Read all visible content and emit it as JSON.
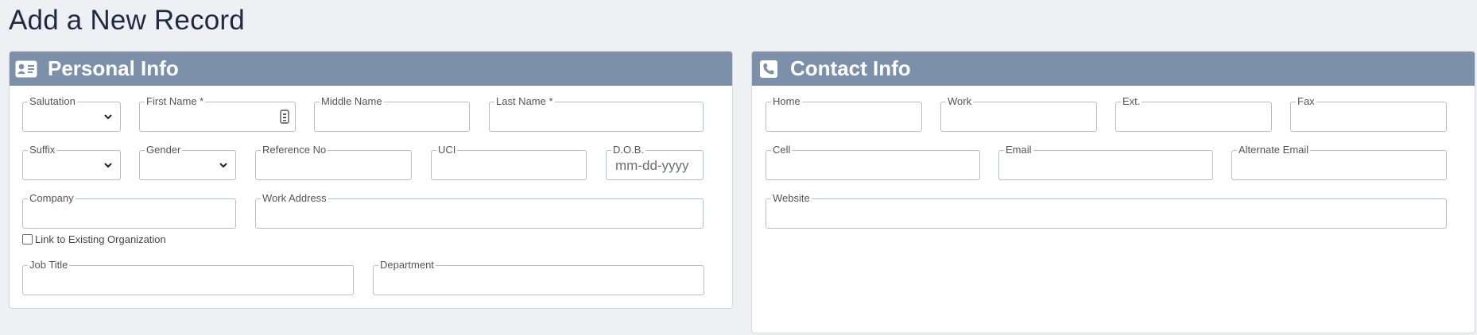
{
  "page": {
    "title": "Add a New Record"
  },
  "personal": {
    "header": "Personal Info",
    "icon": "id-card-icon",
    "fields": {
      "salutation": "Salutation",
      "first_name": "First Name *",
      "middle_name": "Middle Name",
      "last_name": "Last Name *",
      "suffix": "Suffix",
      "gender": "Gender",
      "reference_no": "Reference No",
      "uci": "UCI",
      "dob": "D.O.B.",
      "dob_placeholder": "mm-dd-yyyy",
      "company": "Company",
      "work_address": "Work Address",
      "link_org": "Link to Existing Organization",
      "job_title": "Job Title",
      "department": "Department"
    }
  },
  "contact": {
    "header": "Contact Info",
    "icon": "phone-icon",
    "fields": {
      "home": "Home",
      "work": "Work",
      "ext": "Ext.",
      "fax": "Fax",
      "cell": "Cell",
      "email": "Email",
      "alt_email": "Alternate Email",
      "website": "Website"
    }
  },
  "colors": {
    "header_bg": "#7d90aa",
    "page_bg": "#eff0f4",
    "title": "#1f2a44"
  }
}
